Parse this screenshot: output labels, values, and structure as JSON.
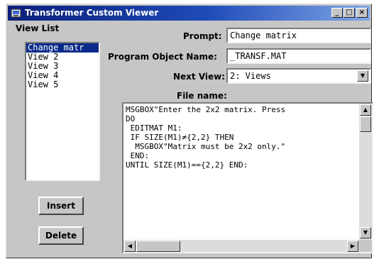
{
  "window": {
    "title": "Transformer Custom Viewer",
    "minimize": "_",
    "maximize": "□",
    "close": "×"
  },
  "view_list": {
    "label": "View List",
    "items": [
      "Change matr",
      "View 2",
      "View 3",
      "View 4",
      "View 5"
    ],
    "selected": "Change matr"
  },
  "form": {
    "prompt_label": "Prompt:",
    "prompt_value": "Change matrix",
    "program_object_label": "Program Object Name:",
    "program_object_value": "_TRANSF.MAT",
    "next_view_label": "Next View:",
    "next_view_value": "2: Views",
    "file_name_label": "File name:"
  },
  "code": {
    "lines": [
      "MSGBOX\"Enter the 2x2 matrix. Press",
      "DO",
      " EDITMAT M1:",
      " IF SIZE(M1)≠{2,2} THEN",
      "  MSGBOX\"Matrix must be 2x2 only.\"",
      " END:",
      "UNTIL SIZE(M1)=={2,2} END:"
    ]
  },
  "buttons": {
    "insert": "Insert",
    "delete": "Delete"
  },
  "icons": {
    "app": "transformer-app-icon",
    "dropdown": "chevron-down-icon",
    "scroll_up": "arrow-up-icon",
    "scroll_down": "arrow-down-icon",
    "scroll_left": "arrow-left-icon",
    "scroll_right": "arrow-right-icon"
  },
  "colors": {
    "title_start": "#0a1f7a",
    "title_end": "#7fa6e6",
    "selection": "#0a2a8a",
    "face": "#c6c6c6"
  }
}
